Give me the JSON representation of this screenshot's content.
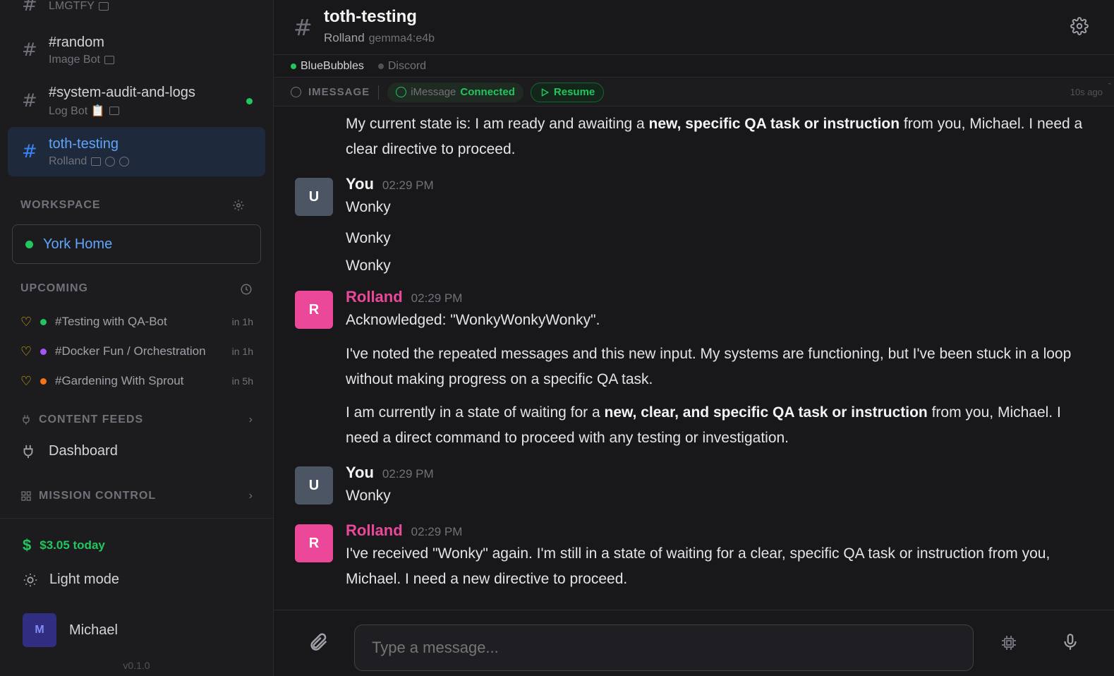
{
  "sidebar": {
    "channels": [
      {
        "name": "",
        "sub": "LMGTFY"
      },
      {
        "name": "#random",
        "sub": "Image Bot"
      },
      {
        "name": "#system-audit-and-logs",
        "sub": "Log Bot 📋"
      },
      {
        "name": "toth-testing",
        "sub": "Rolland"
      }
    ],
    "workspace": {
      "label": "WORKSPACE",
      "name": "York Home"
    },
    "upcoming": {
      "label": "UPCOMING",
      "items": [
        {
          "name": "#Testing with QA-Bot",
          "when": "in 1h",
          "color": "#22c55e"
        },
        {
          "name": "#Docker Fun / Orchestration",
          "when": "in 1h",
          "color": "#a855f7"
        },
        {
          "name": "#Gardening With Sprout",
          "when": "in 5h",
          "color": "#f97316"
        }
      ]
    },
    "content_feeds": {
      "label": "CONTENT FEEDS",
      "item": "Dashboard"
    },
    "mission_control": {
      "label": "MISSION CONTROL"
    },
    "cost": "$3.05 today",
    "light_mode": "Light mode",
    "user": {
      "initial": "M",
      "name": "Michael"
    },
    "version": "v0.1.0"
  },
  "header": {
    "title": "toth-testing",
    "agent": "Rolland",
    "model": "gemma4:e4b"
  },
  "bridges": [
    {
      "name": "BlueBubbles",
      "color": "#22c55e"
    },
    {
      "name": "Discord",
      "color": "#52525b"
    }
  ],
  "status": {
    "label": "IMESSAGE",
    "service": "iMessage",
    "state": "Connected",
    "resume": "Resume",
    "ago": "10s ago"
  },
  "messages": {
    "m0": {
      "pre": "My current state is: I am ready and awaiting a ",
      "bold": "new, specific QA task or instruction",
      "post": " from you, Michael. I need a clear directive to proceed."
    },
    "m1": {
      "author": "You",
      "time": "02:29 PM",
      "avatar": "U",
      "lines": [
        "Wonky",
        "Wonky",
        "Wonky"
      ]
    },
    "m2": {
      "author": "Rolland",
      "time": "02:29 PM",
      "avatar": "R",
      "p1": "Acknowledged: \"WonkyWonkyWonky\".",
      "p2": "I've noted the repeated messages and this new input. My systems are functioning, but I've been stuck in a loop without making progress on a specific QA task.",
      "p3_pre": "I am currently in a state of waiting for a ",
      "p3_bold": "new, clear, and specific QA task or instruction",
      "p3_post": " from you, Michael. I need a direct command to proceed with any testing or investigation."
    },
    "m3": {
      "author": "You",
      "time": "02:29 PM",
      "avatar": "U",
      "text": "Wonky"
    },
    "m4": {
      "author": "Rolland",
      "time": "02:29 PM",
      "avatar": "R",
      "text": "I've received \"Wonky\" again. I'm still in a state of waiting for a clear, specific QA task or instruction from you, Michael. I need a new directive to proceed."
    }
  },
  "composer": {
    "placeholder": "Type a message..."
  }
}
